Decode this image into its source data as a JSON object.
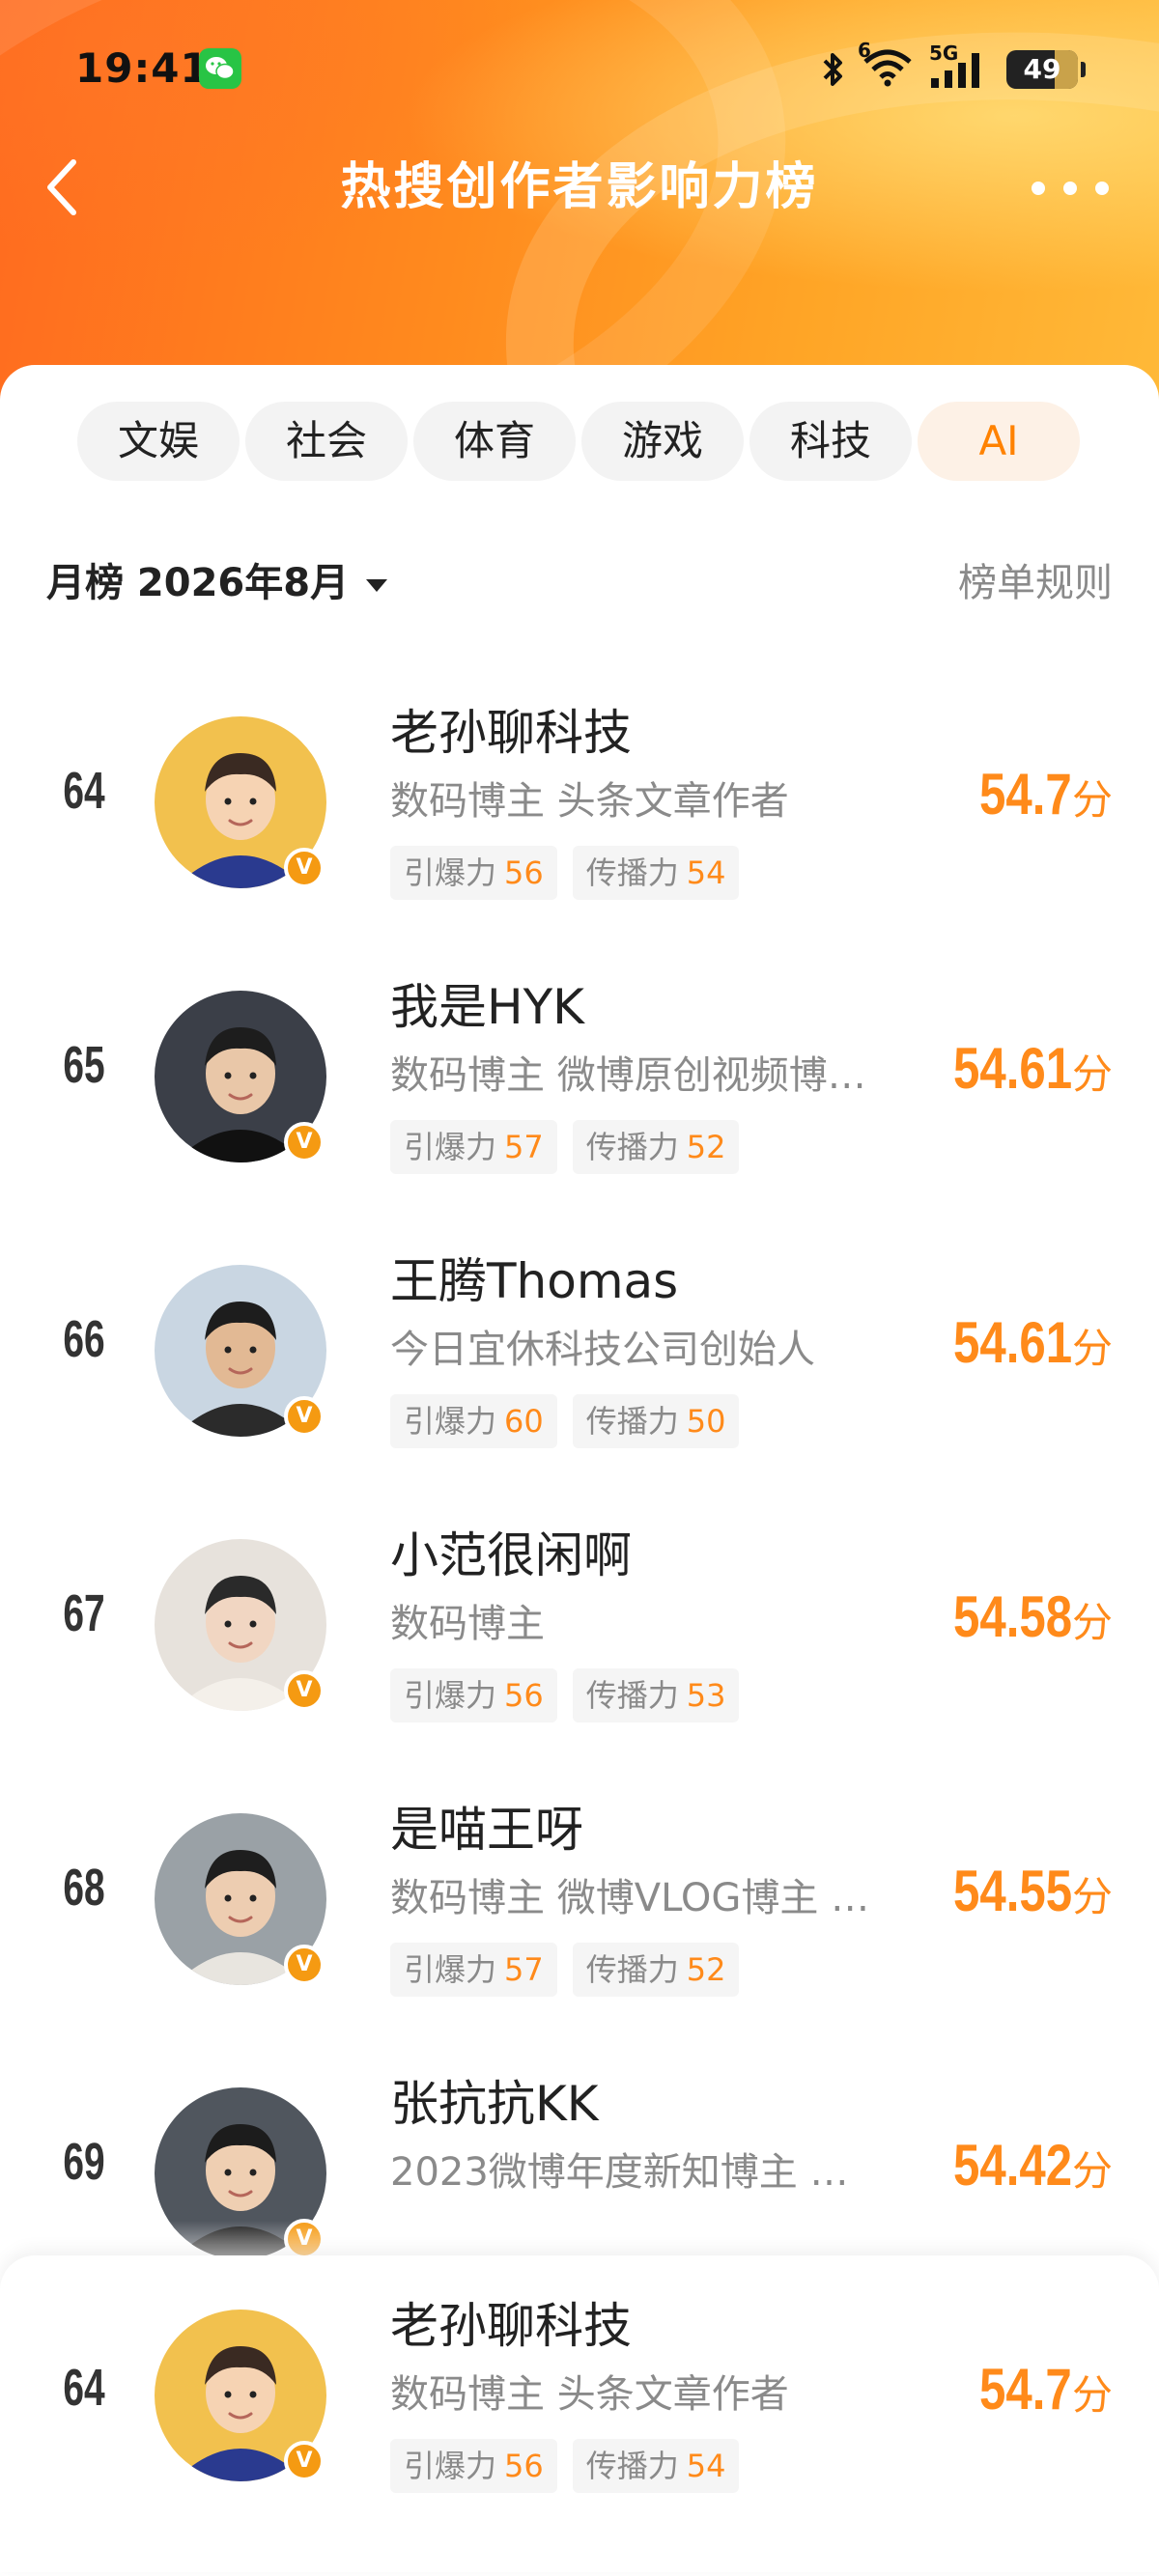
{
  "status_bar": {
    "time": "19:41",
    "network": "5G",
    "wifi_badge": "6",
    "battery": "49",
    "icons": [
      "wechat-icon",
      "bluetooth-icon",
      "wifi-icon",
      "signal-icon",
      "battery-icon"
    ]
  },
  "nav": {
    "title": "热搜创作者影响力榜",
    "back_icon": "chevron-left-icon",
    "more_icon": "more-dots-icon"
  },
  "tabs": [
    "文娱",
    "社会",
    "体育",
    "游戏",
    "科技",
    "AI"
  ],
  "active_tab": "AI",
  "filter": {
    "period": "月榜 2026年8月",
    "rules": "榜单规则"
  },
  "metric_labels": {
    "burst": "引爆力",
    "spread": "传播力"
  },
  "score_unit": "分",
  "verified_badge": "V",
  "colors": {
    "accent": "#ff8a1a",
    "header_start": "#ff6a1f",
    "header_end": "#ffb938",
    "tab_active_bg": "#fdf1e6"
  },
  "list": [
    {
      "rank": "64",
      "name": "老孙聊科技",
      "desc": "数码博主 头条文章作者",
      "burst": "56",
      "spread": "54",
      "score": "54.7"
    },
    {
      "rank": "65",
      "name": "我是HYK",
      "desc": "数码博主 微博原创视频博…",
      "burst": "57",
      "spread": "52",
      "score": "54.61"
    },
    {
      "rank": "66",
      "name": "王腾Thomas",
      "desc": "今日宜休科技公司创始人",
      "burst": "60",
      "spread": "50",
      "score": "54.61"
    },
    {
      "rank": "67",
      "name": "小范很闲啊",
      "desc": "数码博主",
      "burst": "56",
      "spread": "53",
      "score": "54.58"
    },
    {
      "rank": "68",
      "name": "是喵王呀",
      "desc": "数码博主 微博VLOG博主 …",
      "burst": "57",
      "spread": "52",
      "score": "54.55"
    },
    {
      "rank": "69",
      "name": "张抗抗KK",
      "desc": "2023微博年度新知博主 …",
      "burst": "",
      "spread": "",
      "score": "54.42"
    }
  ],
  "my_rank": {
    "rank": "64",
    "name": "老孙聊科技",
    "desc": "数码博主 头条文章作者",
    "burst": "56",
    "spread": "54",
    "score": "54.7"
  }
}
